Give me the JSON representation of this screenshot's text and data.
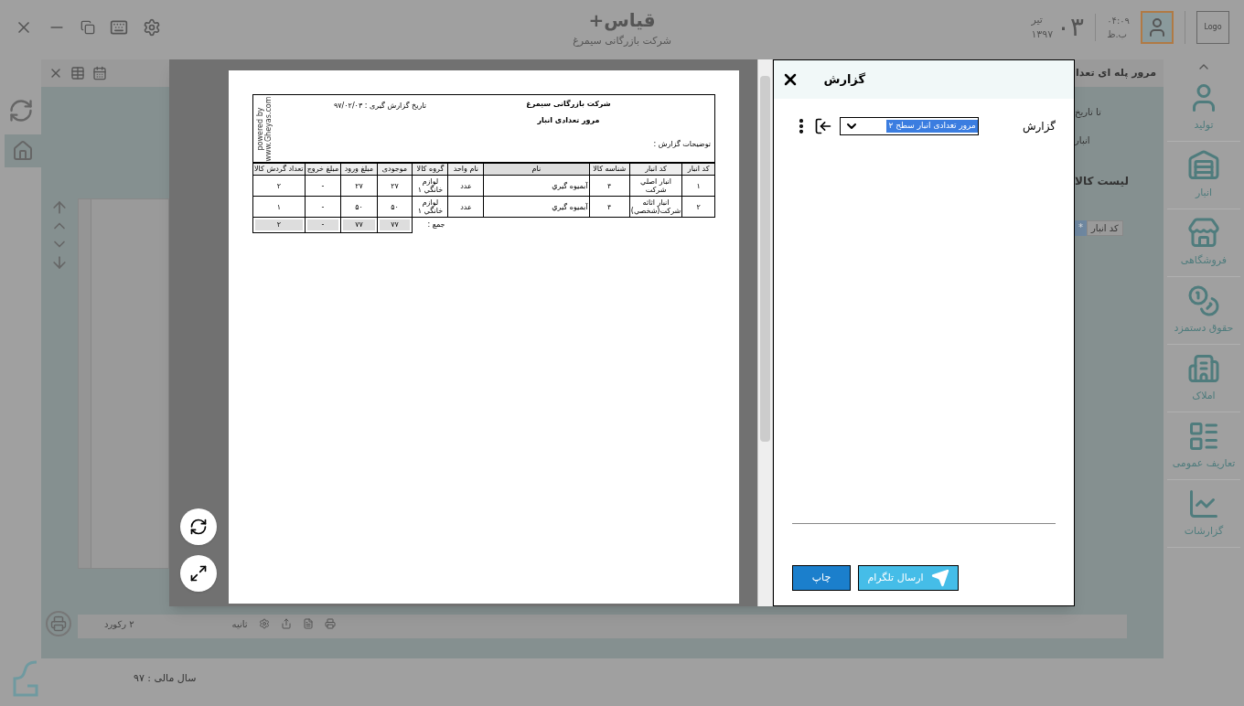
{
  "header": {
    "title": "قیاس+",
    "company": "شرکت بازرگانی سیمرغ",
    "day": "۰۳",
    "month": "تیر",
    "year": "۱۳۹۷",
    "time": "۰۴:۰۹",
    "period": "ب.ظ",
    "logo": "Logo"
  },
  "sidebar": {
    "items": [
      {
        "label": "تولید",
        "kind": "production"
      },
      {
        "label": "انبار",
        "kind": "warehouse"
      },
      {
        "label": "فروشگاهی",
        "kind": "store"
      },
      {
        "label": "حقوق دستمزد",
        "kind": "payroll"
      },
      {
        "label": "املاک",
        "kind": "estate"
      },
      {
        "label": "تعاریف عمومی",
        "kind": "definitions"
      },
      {
        "label": "گزارشات",
        "kind": "reports"
      }
    ]
  },
  "form": {
    "title": "مرور پله ای تعدا",
    "fields": [
      "تا تاریخ",
      "انبار"
    ],
    "list_title": "لیست کالا",
    "grid_header": "کد انبار",
    "row_marker": "*"
  },
  "bottom_bar": {
    "records": "۲ رکورد",
    "interval": "ثانیه"
  },
  "footer": {
    "fiscal_year": "سال مالی : ۹۷"
  },
  "preview": {
    "company": "شرکت بازرگانی سیمرغ",
    "title": "مرور تعدادی انبار",
    "date": "تاریخ گزارش گیری : ۹۷/۰۲/۰۳",
    "notes_label": "توضیحات گزارش :",
    "powered_by": "powered by www.Gheyas.com",
    "columns": [
      "کد انبار",
      "کد انبار",
      "شناسه کالا",
      "نام",
      "نام واحد",
      "گروه کالا",
      "موجودی",
      "مبلغ ورود",
      "مبلغ خروج",
      "تعداد گردش کالا"
    ],
    "rows": [
      [
        "۱",
        "انبار اصلي شركت",
        "۴",
        "آبميوه گيري",
        "عدد",
        "لوازم خانگي ۱",
        "۲۷",
        "۲۷",
        "-",
        "۲"
      ],
      [
        "۲",
        "انبار اثاثه شركت(شخصي)",
        "۴",
        "آبميوه گيري",
        "عدد",
        "لوازم خانگي ۱",
        "۵۰",
        "۵۰",
        "-",
        "۱"
      ]
    ],
    "total_label": "جمع :",
    "totals": [
      "۷۷",
      "۷۷",
      "-",
      "۲"
    ]
  },
  "report_panel": {
    "title": "گزارش",
    "field_label": "گزارش",
    "selected_report": "مرور تعدادی انبار سطح ۲",
    "buttons": [
      {
        "label": "ارسال تلگرام",
        "kind": "telegram"
      },
      {
        "label": "چاپ",
        "kind": "print"
      }
    ]
  }
}
